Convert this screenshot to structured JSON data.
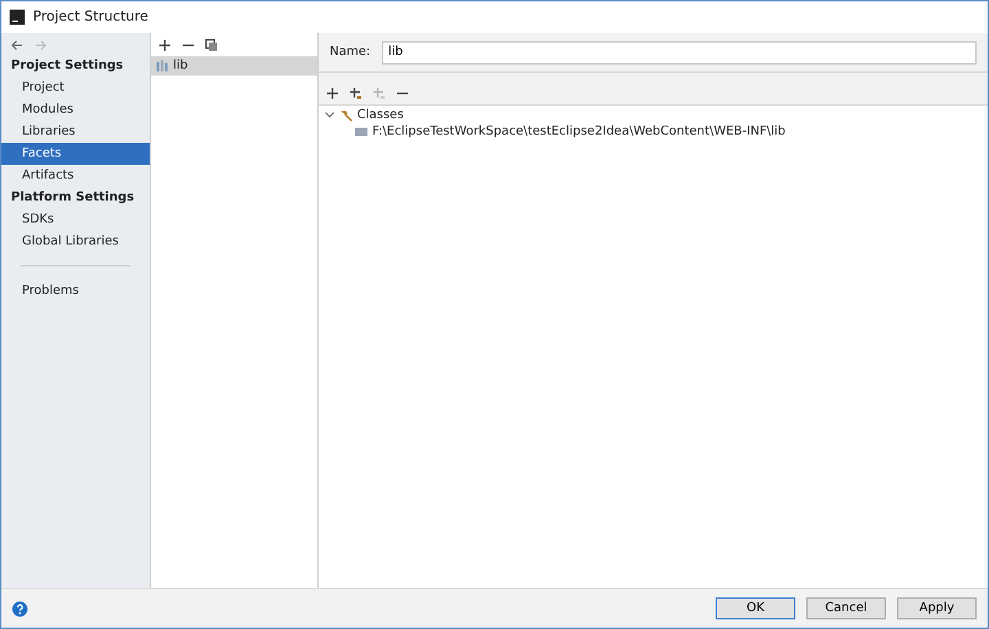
{
  "window": {
    "title": "Project Structure"
  },
  "sidebar": {
    "sections": [
      {
        "title": "Project Settings",
        "items": [
          {
            "label": "Project",
            "selected": false
          },
          {
            "label": "Modules",
            "selected": false
          },
          {
            "label": "Libraries",
            "selected": false
          },
          {
            "label": "Facets",
            "selected": true
          },
          {
            "label": "Artifacts",
            "selected": false
          }
        ]
      },
      {
        "title": "Platform Settings",
        "items": [
          {
            "label": "SDKs",
            "selected": false
          },
          {
            "label": "Global Libraries",
            "selected": false
          }
        ]
      }
    ],
    "footer_items": [
      {
        "label": "Problems",
        "selected": false
      }
    ]
  },
  "list": {
    "items": [
      {
        "label": "lib",
        "selected": true
      }
    ]
  },
  "detail": {
    "name_label": "Name:",
    "name_value": "lib",
    "tree": [
      {
        "label": "Classes",
        "expanded": true,
        "children": [
          {
            "label": "F:\\EclipseTestWorkSpace\\testEclipse2Idea\\WebContent\\WEB-INF\\lib"
          }
        ]
      }
    ]
  },
  "buttons": [
    {
      "label": "OK",
      "kind": "default"
    },
    {
      "label": "Cancel",
      "kind": "normal"
    },
    {
      "label": "Apply",
      "kind": "normal"
    }
  ]
}
